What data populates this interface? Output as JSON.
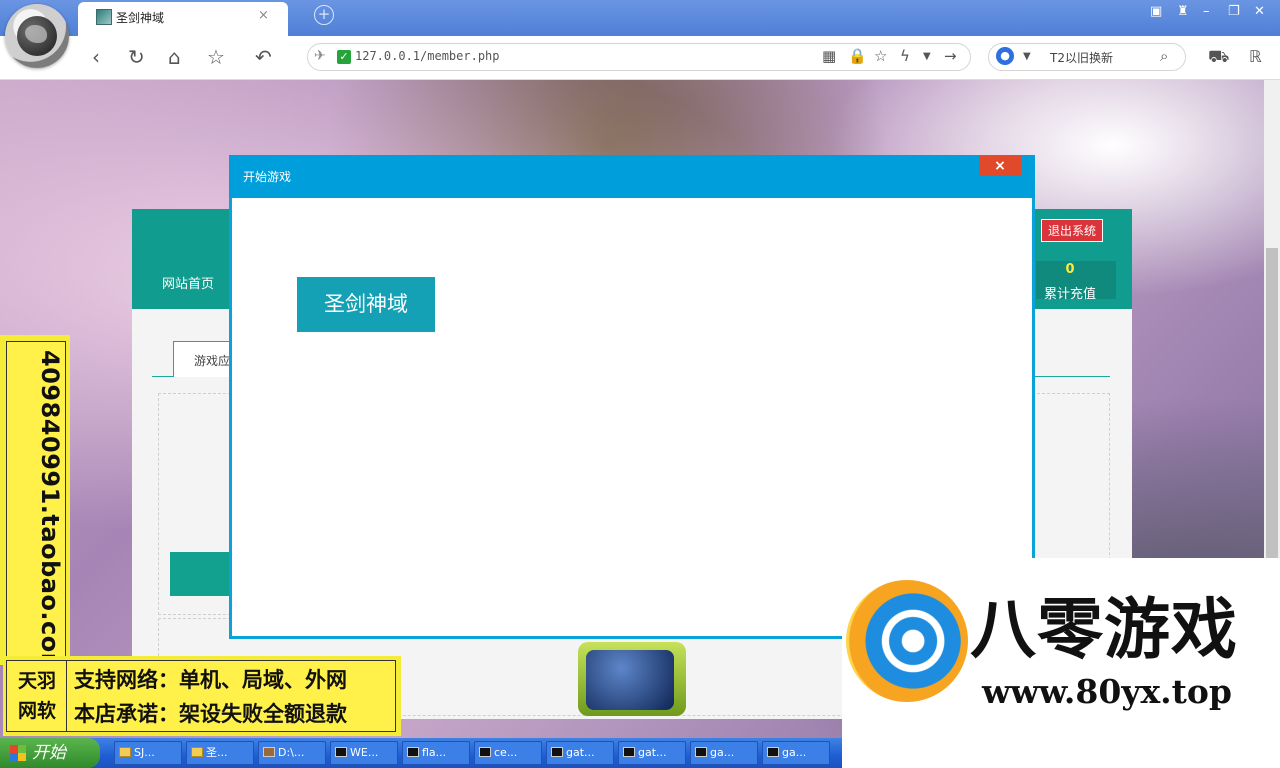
{
  "browser": {
    "tab_title": "圣剑神域",
    "tab_close": "×",
    "new_tab": "+",
    "address_url": "127.0.0.1/member.php",
    "search_text": "T2以旧换新"
  },
  "site": {
    "nav_home": "网站首页",
    "logout_label": "退出系统",
    "recharge_value": "0",
    "recharge_label": "累计充值",
    "tab_game": "游戏应"
  },
  "modal": {
    "title": "开始游戏",
    "close_label": "×",
    "game_button": "圣剑神域"
  },
  "watermark": {
    "vertical_text": "409840991.taobao.com",
    "brand_line1": "天羽",
    "brand_line2": "网软",
    "support_line": "支持网络：单机、局域、外网",
    "promise_line": "本店承诺：架设失败全额退款",
    "ad_title": "八零游戏",
    "ad_url": "www.80yx.top"
  },
  "taskbar": {
    "start_label": "开始",
    "items": [
      "SJ...",
      "圣...",
      "D:\\...",
      "WE...",
      "fla...",
      "ce...",
      "gat...",
      "gat...",
      "ga...",
      "ga..."
    ]
  },
  "colors": {
    "modal_header": "#009fdc",
    "site_teal": "#109c8e",
    "logout_red": "#d9343a",
    "close_red": "#e04a2a"
  }
}
